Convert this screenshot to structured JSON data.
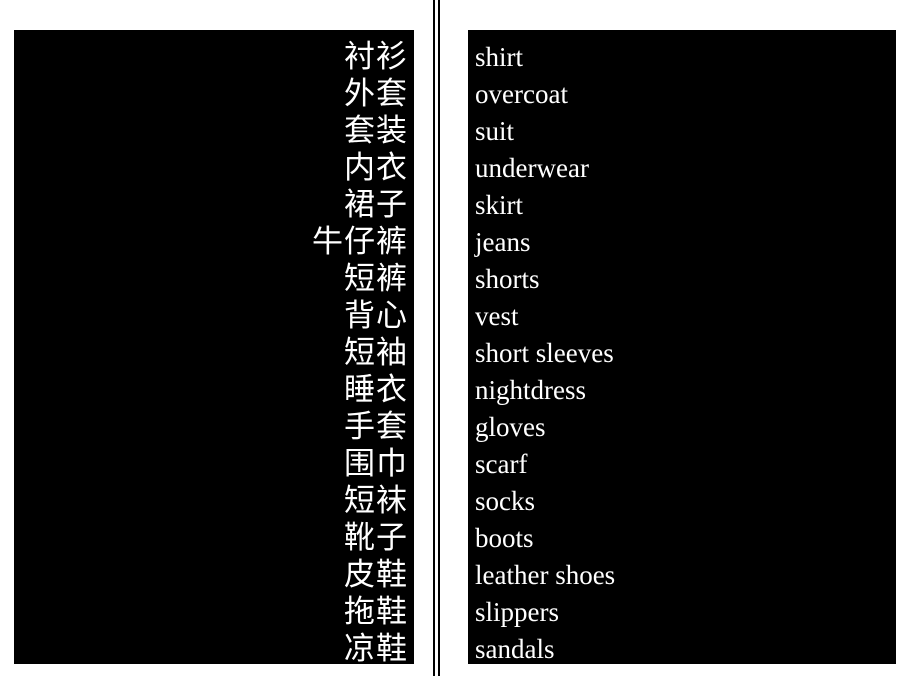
{
  "layout": {
    "background_color": "#ffffff",
    "panel_color": "#000000",
    "text_color": "#ffffff",
    "divider_color": "#000000"
  },
  "panels": {
    "chinese": {
      "language": "zh",
      "alignment": "right",
      "entries": [
        "衬衫",
        "外套",
        "套装",
        "内衣",
        "裙子",
        "牛仔裤",
        "短裤",
        "背心",
        "短袖",
        "睡衣",
        "手套",
        "围巾",
        "短袜",
        "靴子",
        "皮鞋",
        "拖鞋",
        "凉鞋"
      ]
    },
    "english": {
      "language": "en",
      "alignment": "left",
      "entries": [
        "shirt",
        "overcoat",
        "suit",
        "underwear",
        "skirt",
        "jeans",
        "shorts",
        "vest",
        "short sleeves",
        "nightdress",
        "gloves",
        "scarf",
        "socks",
        "boots",
        "leather shoes",
        "slippers",
        "sandals"
      ]
    }
  }
}
